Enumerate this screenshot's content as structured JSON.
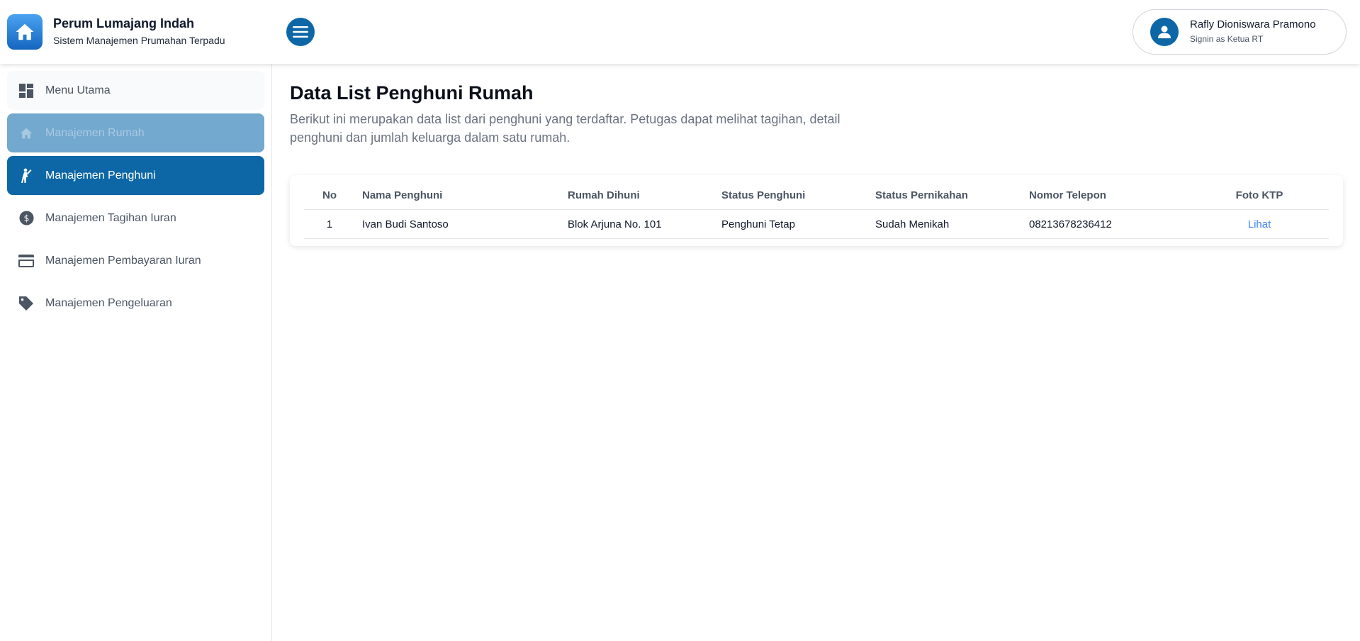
{
  "header": {
    "app_title": "Perum Lumajang Indah",
    "app_subtitle": "Sistem Manajemen Prumahan Terpadu",
    "menu_icon": "hamburger-icon",
    "user": {
      "name": "Rafly Dioniswara Pramono",
      "role": "Signin as Ketua RT",
      "icon": "user-icon"
    }
  },
  "sidebar": {
    "items": [
      {
        "label": "Menu Utama",
        "icon": "dashboard-icon",
        "state": "default"
      },
      {
        "label": "Manajemen Rumah",
        "icon": "home-icon",
        "state": "hover"
      },
      {
        "label": "Manajemen Penghuni",
        "icon": "person-waving-icon",
        "state": "active"
      },
      {
        "label": "Manajemen Tagihan Iuran",
        "icon": "dollar-circle-icon",
        "state": "default"
      },
      {
        "label": "Manajemen Pembayaran Iuran",
        "icon": "credit-card-icon",
        "state": "default"
      },
      {
        "label": "Manajemen Pengeluaran",
        "icon": "tag-icon",
        "state": "default"
      }
    ]
  },
  "main": {
    "title": "Data List Penghuni Rumah",
    "description": "Berikut ini merupakan data list dari penghuni yang terdaftar. Petugas dapat melihat tagihan, detail penghuni dan jumlah keluarga dalam satu rumah.",
    "table": {
      "columns": [
        "No",
        "Nama Penghuni",
        "Rumah Dihuni",
        "Status Penghuni",
        "Status Pernikahan",
        "Nomor Telepon",
        "Foto KTP"
      ],
      "rows": [
        {
          "no": "1",
          "name": "Ivan Budi Santoso",
          "house": "Blok Arjuna No. 101",
          "status": "Penghuni Tetap",
          "marital": "Sudah Menikah",
          "phone": "08213678236412",
          "ktp_link": "Lihat"
        }
      ]
    }
  },
  "colors": {
    "primary": "#0d67a6",
    "primary_muted": "#73a8cf",
    "link": "#3b82f6",
    "text_muted": "#6b7280"
  }
}
